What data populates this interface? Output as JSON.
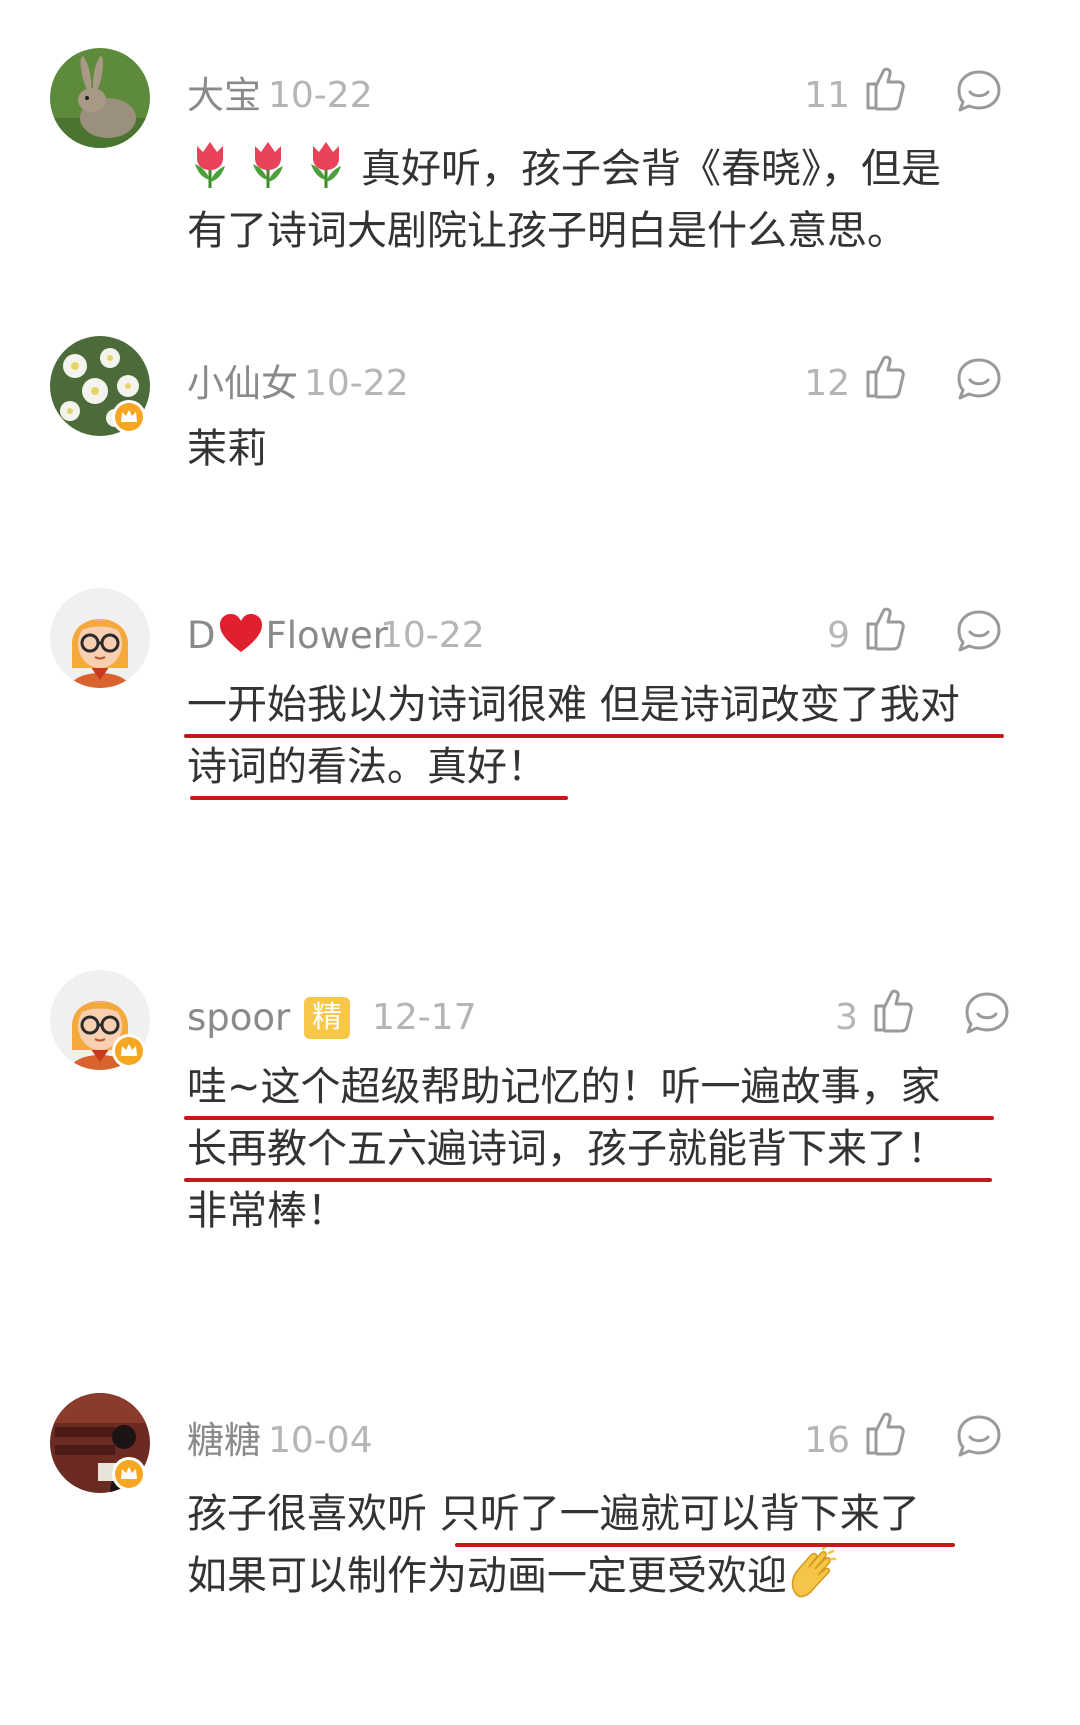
{
  "comments": [
    {
      "username": "大宝",
      "date": "10-22",
      "likes": "11",
      "text_lines": [
        "真好听，孩子会背《春晓》，但是",
        "有了诗词大剧院让孩子明白是什么意思。"
      ],
      "emojis": [
        "tulip-emoji",
        "tulip-emoji",
        "tulip-emoji"
      ],
      "avatar_icon": "rabbit-avatar",
      "vip": false
    },
    {
      "username": "小仙女",
      "date": "10-22",
      "likes": "12",
      "text_lines": [
        "茉莉"
      ],
      "avatar_icon": "flowers-avatar",
      "vip": true
    },
    {
      "username_parts": [
        "D",
        "Flower"
      ],
      "username_emoji": "heart-emoji",
      "date": "10-22",
      "likes": "9",
      "text_lines": [
        "一开始我以为诗词很难 但是诗词改变了我对",
        "诗词的看法。真好！"
      ],
      "avatar_icon": "cartoon-girl-avatar",
      "vip": false
    },
    {
      "username": "spoor",
      "badge": "精",
      "date": "12-17",
      "likes": "3",
      "text_lines": [
        "哇~这个超级帮助记忆的！听一遍故事，家",
        "长再教个五六遍诗词，孩子就能背下来了！",
        "非常棒！"
      ],
      "avatar_icon": "cartoon-girl-avatar",
      "vip": true
    },
    {
      "username": "糖糖",
      "date": "10-04",
      "likes": "16",
      "text_lines_split": [
        "孩子很喜欢听 ",
        "只听了一遍就可以背下来了"
      ],
      "text_lines": [
        "如果可以制作为动画一定更受欢迎"
      ],
      "line_emoji": "clapping-hands-emoji",
      "avatar_icon": "photo-avatar",
      "vip": true
    }
  ],
  "colors": {
    "username": "#8a8a8a",
    "date": "#b5b5b5",
    "text": "#333333",
    "underline": "#c21a1a",
    "badge": "#f7c64b",
    "vip_crown": "#f5a623"
  }
}
